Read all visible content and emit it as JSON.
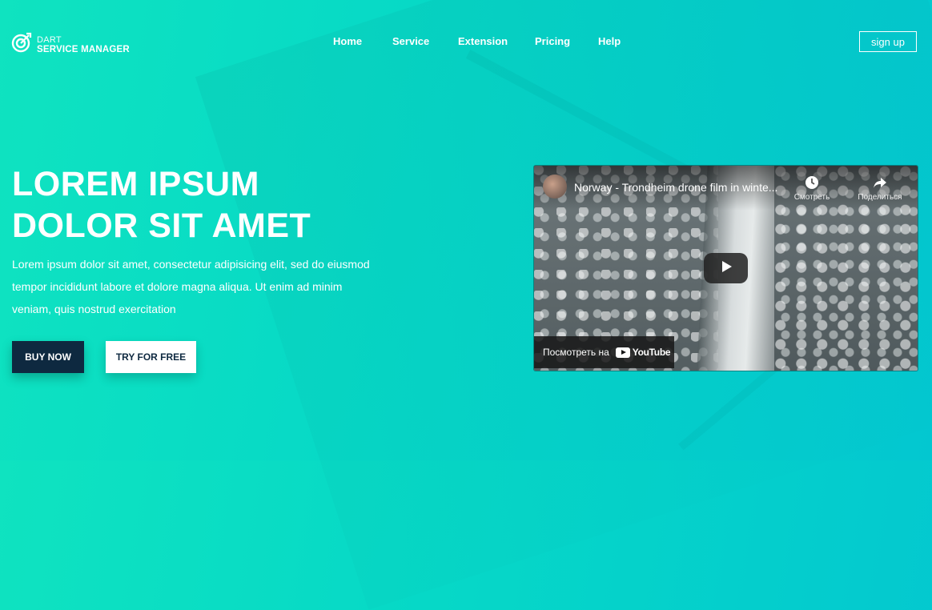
{
  "brand": {
    "line1": "DART",
    "line2": "SERVICE MANAGER"
  },
  "nav": {
    "items": [
      {
        "label": "Home"
      },
      {
        "label": "Service"
      },
      {
        "label": "Extension"
      },
      {
        "label": "Pricing"
      },
      {
        "label": "Help"
      }
    ],
    "signup_label": "sign up"
  },
  "hero": {
    "title_line1": "LOREM IPSUM",
    "title_line2": "DOLOR SIT AMET",
    "description": "Lorem ipsum dolor sit amet, consectetur adipisicing elit, sed do eiusmod tempor incididunt labore et dolore magna aliqua. Ut enim ad minim veniam, quis nostrud exercitation",
    "buy_label": "BUY NOW",
    "try_label": "TRY FOR FREE"
  },
  "video": {
    "title": "Norway - Trondheim drone film in winte...",
    "watch_later_label": "Смотреть",
    "share_label": "Поделиться",
    "watch_on_label": "Посмотреть на",
    "platform_label": "YouTube"
  },
  "colors": {
    "bg_start": "#0fe3c0",
    "bg_end": "#03c7d0",
    "buy_button": "#0e2940",
    "text": "#ffffff"
  }
}
